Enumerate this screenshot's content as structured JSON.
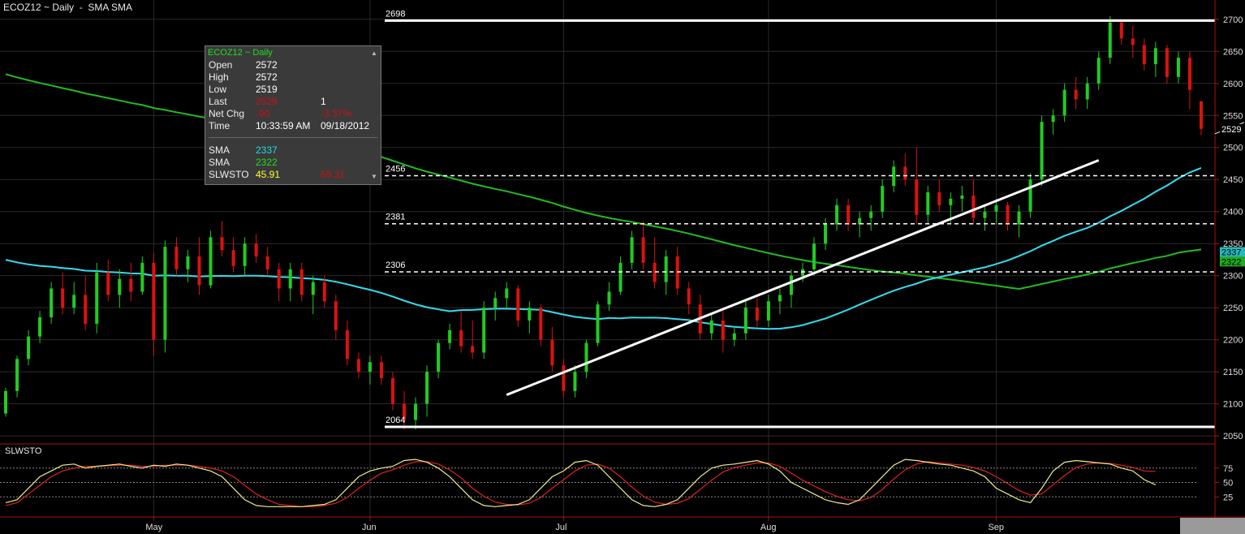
{
  "header": {
    "title": "ECOZ12 ~ Daily  -  SMA SMA"
  },
  "indicator": {
    "title": "SLWSTO"
  },
  "info_panel": {
    "title": "ECOZ12 ~ Daily",
    "rows": [
      {
        "label": "Open",
        "v1": "2572",
        "v2": "",
        "c1": "#ffffff",
        "c2": "#ffffff"
      },
      {
        "label": "High",
        "v1": "2572",
        "v2": "",
        "c1": "#ffffff",
        "c2": "#ffffff"
      },
      {
        "label": "Low",
        "v1": "2519",
        "v2": "",
        "c1": "#ffffff",
        "c2": "#ffffff"
      },
      {
        "label": "Last",
        "v1": "2529",
        "v2": "1",
        "c1": "#cc1111",
        "c2": "#ffffff"
      },
      {
        "label": "Net Chg",
        "v1": "-90",
        "v2": "-3.37%",
        "c1": "#cc1111",
        "c2": "#cc1111"
      },
      {
        "label": "Time",
        "v1": "10:33:59 AM",
        "v2": "09/18/2012",
        "c1": "#ffffff",
        "c2": "#ffffff"
      }
    ],
    "ind_rows": [
      {
        "label": "SMA",
        "v1": "2337",
        "v2": "",
        "c1": "#22dddd",
        "c2": "#ffffff"
      },
      {
        "label": "SMA",
        "v1": "2322",
        "v2": "",
        "c1": "#22dd22",
        "c2": "#ffffff"
      },
      {
        "label": "SLWSTO",
        "v1": "45.91",
        "v2": "69.31",
        "c1": "#ffff33",
        "c2": "#cc1111"
      }
    ]
  },
  "colors": {
    "up": "#22cc22",
    "down": "#dd1111",
    "sma_fast": "#33ddee",
    "sma_slow": "#22bb22",
    "sto_k": "#eeee88",
    "sto_d": "#dd2222",
    "grid": "#2a2a2a",
    "axis": "#aa1111"
  },
  "chart_data": {
    "type": "candlestick",
    "symbol": "ECOZ12",
    "price_range": [
      2040,
      2720
    ],
    "y_ticks": [
      2050,
      2100,
      2150,
      2200,
      2250,
      2300,
      2350,
      2400,
      2450,
      2500,
      2550,
      2600,
      2650,
      2700
    ],
    "x_month_labels": [
      {
        "label": "May",
        "day": 13
      },
      {
        "label": "Jun",
        "day": 32
      },
      {
        "label": "Jul",
        "day": 49
      },
      {
        "label": "Aug",
        "day": 67
      },
      {
        "label": "Sep",
        "day": 87
      }
    ],
    "last_price": 2529,
    "sma_values": [
      2337,
      2322
    ],
    "levels": [
      {
        "value": 2698,
        "label": "2698",
        "style": "solid"
      },
      {
        "value": 2456,
        "label": "2456",
        "style": "dashed"
      },
      {
        "value": 2381,
        "label": "2381",
        "style": "dashed"
      },
      {
        "value": 2306,
        "label": "2306",
        "style": "dashed"
      },
      {
        "value": 2064,
        "label": "2064",
        "style": "solid"
      }
    ],
    "trendline": {
      "from": {
        "day": 44,
        "price": 2114
      },
      "to": {
        "day": 96,
        "price": 2480
      }
    },
    "candles": [
      [
        2085,
        2125,
        2080,
        2120
      ],
      [
        2120,
        2175,
        2110,
        2170
      ],
      [
        2170,
        2215,
        2160,
        2205
      ],
      [
        2205,
        2245,
        2195,
        2235
      ],
      [
        2235,
        2290,
        2225,
        2280
      ],
      [
        2280,
        2305,
        2240,
        2250
      ],
      [
        2250,
        2290,
        2240,
        2270
      ],
      [
        2270,
        2300,
        2215,
        2225
      ],
      [
        2225,
        2320,
        2210,
        2305
      ],
      [
        2305,
        2325,
        2260,
        2270
      ],
      [
        2270,
        2310,
        2250,
        2295
      ],
      [
        2295,
        2320,
        2260,
        2275
      ],
      [
        2275,
        2330,
        2270,
        2320
      ],
      [
        2320,
        2335,
        2175,
        2200
      ],
      [
        2200,
        2355,
        2180,
        2345
      ],
      [
        2345,
        2360,
        2300,
        2310
      ],
      [
        2310,
        2340,
        2290,
        2330
      ],
      [
        2330,
        2360,
        2270,
        2285
      ],
      [
        2285,
        2370,
        2280,
        2360
      ],
      [
        2360,
        2385,
        2330,
        2340
      ],
      [
        2340,
        2360,
        2305,
        2315
      ],
      [
        2315,
        2360,
        2300,
        2350
      ],
      [
        2350,
        2365,
        2320,
        2330
      ],
      [
        2330,
        2345,
        2300,
        2310
      ],
      [
        2310,
        2320,
        2260,
        2280
      ],
      [
        2280,
        2320,
        2260,
        2310
      ],
      [
        2310,
        2320,
        2260,
        2270
      ],
      [
        2270,
        2300,
        2240,
        2290
      ],
      [
        2290,
        2300,
        2250,
        2260
      ],
      [
        2260,
        2270,
        2200,
        2215
      ],
      [
        2215,
        2230,
        2160,
        2170
      ],
      [
        2170,
        2180,
        2140,
        2150
      ],
      [
        2150,
        2175,
        2130,
        2165
      ],
      [
        2165,
        2175,
        2130,
        2140
      ],
      [
        2140,
        2150,
        2090,
        2100
      ],
      [
        2100,
        2120,
        2060,
        2075
      ],
      [
        2075,
        2110,
        2060,
        2100
      ],
      [
        2100,
        2160,
        2080,
        2150
      ],
      [
        2150,
        2200,
        2140,
        2195
      ],
      [
        2195,
        2225,
        2185,
        2215
      ],
      [
        2215,
        2245,
        2180,
        2190
      ],
      [
        2190,
        2230,
        2170,
        2180
      ],
      [
        2180,
        2260,
        2170,
        2250
      ],
      [
        2250,
        2275,
        2230,
        2265
      ],
      [
        2265,
        2290,
        2250,
        2280
      ],
      [
        2280,
        2285,
        2220,
        2230
      ],
      [
        2230,
        2260,
        2210,
        2250
      ],
      [
        2250,
        2255,
        2190,
        2200
      ],
      [
        2200,
        2220,
        2150,
        2160
      ],
      [
        2160,
        2170,
        2110,
        2120
      ],
      [
        2120,
        2160,
        2110,
        2150
      ],
      [
        2150,
        2200,
        2140,
        2195
      ],
      [
        2195,
        2260,
        2190,
        2255
      ],
      [
        2255,
        2290,
        2245,
        2275
      ],
      [
        2275,
        2330,
        2270,
        2320
      ],
      [
        2320,
        2370,
        2310,
        2360
      ],
      [
        2360,
        2385,
        2310,
        2320
      ],
      [
        2320,
        2360,
        2280,
        2290
      ],
      [
        2290,
        2340,
        2270,
        2330
      ],
      [
        2330,
        2345,
        2270,
        2280
      ],
      [
        2280,
        2290,
        2240,
        2255
      ],
      [
        2255,
        2270,
        2200,
        2210
      ],
      [
        2210,
        2240,
        2200,
        2230
      ],
      [
        2230,
        2250,
        2180,
        2200
      ],
      [
        2200,
        2220,
        2190,
        2210
      ],
      [
        2210,
        2260,
        2200,
        2250
      ],
      [
        2250,
        2265,
        2220,
        2230
      ],
      [
        2230,
        2270,
        2220,
        2260
      ],
      [
        2260,
        2280,
        2240,
        2270
      ],
      [
        2270,
        2310,
        2250,
        2300
      ],
      [
        2300,
        2320,
        2290,
        2310
      ],
      [
        2310,
        2360,
        2300,
        2350
      ],
      [
        2350,
        2390,
        2340,
        2380
      ],
      [
        2380,
        2420,
        2370,
        2410
      ],
      [
        2410,
        2420,
        2370,
        2380
      ],
      [
        2380,
        2400,
        2360,
        2390
      ],
      [
        2390,
        2410,
        2370,
        2400
      ],
      [
        2400,
        2450,
        2390,
        2440
      ],
      [
        2440,
        2480,
        2430,
        2470
      ],
      [
        2470,
        2490,
        2440,
        2450
      ],
      [
        2450,
        2500,
        2380,
        2395
      ],
      [
        2395,
        2440,
        2380,
        2430
      ],
      [
        2430,
        2450,
        2400,
        2410
      ],
      [
        2410,
        2430,
        2380,
        2420
      ],
      [
        2420,
        2440,
        2400,
        2425
      ],
      [
        2425,
        2450,
        2380,
        2390
      ],
      [
        2390,
        2410,
        2370,
        2400
      ],
      [
        2400,
        2420,
        2380,
        2410
      ],
      [
        2410,
        2415,
        2370,
        2380
      ],
      [
        2380,
        2410,
        2360,
        2400
      ],
      [
        2400,
        2460,
        2390,
        2450
      ],
      [
        2450,
        2550,
        2440,
        2540
      ],
      [
        2540,
        2560,
        2520,
        2550
      ],
      [
        2550,
        2600,
        2540,
        2590
      ],
      [
        2590,
        2610,
        2560,
        2575
      ],
      [
        2575,
        2610,
        2560,
        2600
      ],
      [
        2600,
        2650,
        2590,
        2640
      ],
      [
        2640,
        2705,
        2630,
        2695
      ],
      [
        2695,
        2700,
        2660,
        2670
      ],
      [
        2670,
        2690,
        2640,
        2660
      ],
      [
        2660,
        2670,
        2620,
        2630
      ],
      [
        2630,
        2665,
        2610,
        2655
      ],
      [
        2655,
        2660,
        2600,
        2610
      ],
      [
        2610,
        2650,
        2600,
        2640
      ],
      [
        2640,
        2650,
        2560,
        2590
      ],
      [
        2572,
        2572,
        2519,
        2529
      ]
    ],
    "stochastic": {
      "levels": [
        25,
        50,
        75
      ],
      "range": [
        0,
        100
      ],
      "k": [
        15,
        20,
        40,
        60,
        70,
        80,
        82,
        75,
        78,
        80,
        82,
        78,
        75,
        80,
        78,
        82,
        80,
        75,
        70,
        60,
        40,
        20,
        10,
        8,
        8,
        8,
        8,
        10,
        12,
        20,
        40,
        60,
        70,
        75,
        78,
        88,
        90,
        85,
        75,
        60,
        40,
        20,
        10,
        8,
        10,
        12,
        20,
        40,
        60,
        70,
        85,
        88,
        80,
        60,
        40,
        20,
        10,
        8,
        12,
        20,
        40,
        60,
        75,
        80,
        82,
        85,
        88,
        82,
        70,
        50,
        40,
        30,
        20,
        15,
        12,
        20,
        40,
        60,
        80,
        90,
        88,
        85,
        82,
        80,
        75,
        70,
        60,
        40,
        30,
        20,
        15,
        40,
        70,
        85,
        88,
        86,
        84,
        82,
        75,
        70,
        55,
        45.91
      ],
      "d": [
        10,
        15,
        30,
        45,
        60,
        70,
        75,
        78,
        78,
        79,
        80,
        80,
        78,
        78,
        80,
        80,
        80,
        78,
        75,
        70,
        60,
        45,
        30,
        20,
        12,
        10,
        8,
        8,
        10,
        14,
        24,
        40,
        54,
        66,
        72,
        80,
        86,
        86,
        82,
        72,
        58,
        40,
        26,
        16,
        12,
        11,
        14,
        24,
        40,
        55,
        70,
        80,
        82,
        75,
        60,
        42,
        26,
        16,
        12,
        14,
        22,
        38,
        54,
        68,
        76,
        80,
        84,
        84,
        78,
        66,
        54,
        44,
        34,
        26,
        20,
        18,
        24,
        38,
        56,
        72,
        82,
        86,
        84,
        82,
        80,
        76,
        70,
        60,
        48,
        36,
        28,
        30,
        46,
        62,
        76,
        82,
        84,
        83,
        80,
        76,
        70,
        69.31
      ]
    }
  }
}
